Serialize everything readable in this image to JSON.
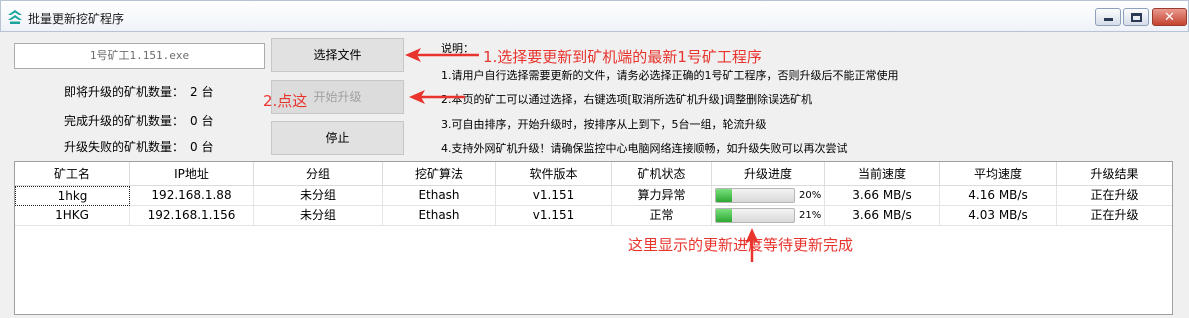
{
  "window": {
    "title": "批量更新挖矿程序",
    "min_icon": "minimize-icon",
    "max_icon": "maximize-icon",
    "close_icon": "close-icon",
    "close_glyph": "✕"
  },
  "file": {
    "value": "1号矿工1.151.exe"
  },
  "buttons": {
    "choose": "选择文件",
    "start": "开始升级",
    "stop": "停止"
  },
  "stats": {
    "pending_label": "即将升级的矿机数量：",
    "pending_value": "2 台",
    "done_label": "完成升级的矿机数量：",
    "done_value": "0 台",
    "failed_label": "升级失败的矿机数量：",
    "failed_value": "0 台"
  },
  "instructions": {
    "heading": "说明：",
    "lines": [
      "1.请用户自行选择需要更新的文件，请务必选择正确的1号矿工程序，否则升级后不能正常使用",
      "2.本页的矿工可以通过选择，右键选项[取消所选矿机升级]调整删除误选矿机",
      "3.可自由排序，开始升级时，按排序从上到下，5台一组，轮流升级",
      "4.支持外网矿机升级！请确保监控中心电脑网络连接顺畅，如升级失败可以再次尝试"
    ]
  },
  "annotations": {
    "a1": "1.选择要更新到矿机端的最新1号矿工程序",
    "a2": "2.点这",
    "bottom": "这里显示的更新进度等待更新完成",
    "color": "#e8342d"
  },
  "table": {
    "columns": [
      "矿工名",
      "IP地址",
      "分组",
      "挖矿算法",
      "软件版本",
      "矿机状态",
      "升级进度",
      "当前速度",
      "平均速度",
      "升级结果"
    ],
    "rows": [
      {
        "name": "1hkg",
        "ip": "192.168.1.88",
        "group": "未分组",
        "algo": "Ethash",
        "version": "v1.151",
        "status": "算力异常",
        "progress": 0.2,
        "progress_text": "20%",
        "cur_speed": "3.66 MB/s",
        "avg_speed": "4.16 MB/s",
        "result": "正在升级"
      },
      {
        "name": "1HKG",
        "ip": "192.168.1.156",
        "group": "未分组",
        "algo": "Ethash",
        "version": "v1.151",
        "status": "正常",
        "progress": 0.21,
        "progress_text": "21%",
        "cur_speed": "3.66 MB/s",
        "avg_speed": "4.03 MB/s",
        "result": "正在升级"
      }
    ]
  },
  "colors": {
    "progress_fill": "#2ea833",
    "annotation": "#e8342d"
  }
}
